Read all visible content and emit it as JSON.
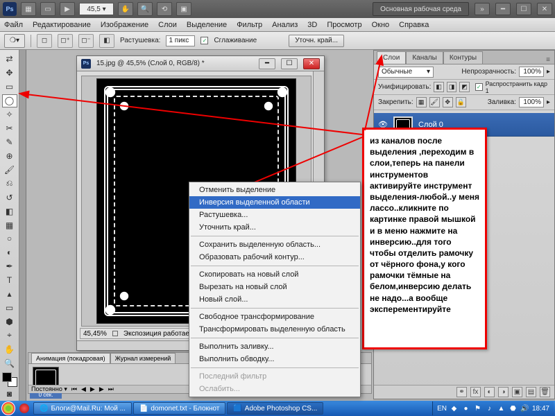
{
  "app": {
    "zoom_pct": "45,5",
    "workspace_btn": "Основная рабочая среда"
  },
  "menu": [
    "Файл",
    "Редактирование",
    "Изображение",
    "Слои",
    "Выделение",
    "Фильтр",
    "Анализ",
    "3D",
    "Просмотр",
    "Окно",
    "Справка"
  ],
  "optbar": {
    "feather_label": "Растушевка:",
    "feather_value": "1 пикс",
    "antialias": "Сглаживание",
    "refine": "Уточн. край..."
  },
  "doc": {
    "title": "15.jpg @ 45,5% (Слой 0, RGB/8) *",
    "status_zoom": "45,45%",
    "status_text": "Экспозиция работает тол"
  },
  "ctx": {
    "items": [
      {
        "t": "Отменить выделение",
        "d": false
      },
      {
        "t": "Инверсия выделенной области",
        "d": false,
        "hi": true
      },
      {
        "t": "Растушевка...",
        "d": false
      },
      {
        "t": "Уточнить край...",
        "d": false
      },
      {
        "sep": true
      },
      {
        "t": "Сохранить выделенную область...",
        "d": false
      },
      {
        "t": "Образовать рабочий контур...",
        "d": false
      },
      {
        "sep": true
      },
      {
        "t": "Скопировать на новый слой",
        "d": false
      },
      {
        "t": "Вырезать на новый слой",
        "d": false
      },
      {
        "t": "Новый слой...",
        "d": false
      },
      {
        "sep": true
      },
      {
        "t": "Свободное трансформирование",
        "d": false
      },
      {
        "t": "Трансформировать выделенную область",
        "d": false
      },
      {
        "sep": true
      },
      {
        "t": "Выполнить заливку...",
        "d": false
      },
      {
        "t": "Выполнить обводку...",
        "d": false
      },
      {
        "sep": true
      },
      {
        "t": "Последний фильтр",
        "d": true
      },
      {
        "t": "Ослабить...",
        "d": true
      }
    ]
  },
  "layers": {
    "tabs": [
      "Слои",
      "Каналы",
      "Контуры"
    ],
    "mode": "Обычные",
    "opacity_label": "Непрозрачность:",
    "opacity_val": "100%",
    "unify_label": "Унифицировать:",
    "propagate": "Распространить кадр 1",
    "lock_label": "Закрепить:",
    "fill_label": "Заливка:",
    "fill_val": "100%",
    "layer0": "Слой 0"
  },
  "anim": {
    "tabs": [
      "Анимация (покадровая)",
      "Журнал измерений"
    ],
    "frame_time": "0 сек.",
    "loop": "Постоянно"
  },
  "annotation": "из каналов  после выделения ,переходим в слои,теперь на панели инструментов активируйте инструмент выделения-любой..у меня лассо..кликните по картинке правой мышкой и в меню нажмите на инверсию..для того чтобы отделить рамочку от чёрного фона,у кого рамочки тёмные на белом,инверсию делать не надо...а вообще эксперементируйте",
  "taskbar": {
    "btn1": "Блоги@Mail.Ru: Мой ...",
    "btn2": "domonet.txt - Блокнот",
    "btn3": "Adobe Photoshop CS...",
    "lang": "EN",
    "time": "18:47"
  }
}
